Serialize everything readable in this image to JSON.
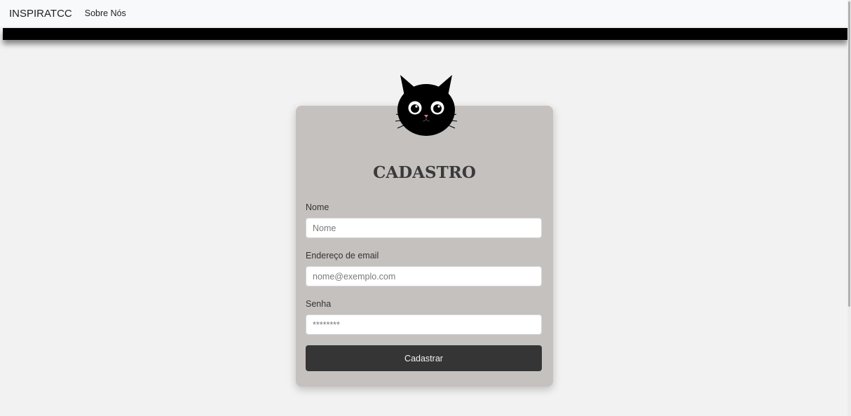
{
  "navbar": {
    "brand": "INSPIRATCC",
    "links": [
      {
        "label": "Sobre Nós"
      }
    ]
  },
  "form": {
    "title": "CADASTRO",
    "fields": [
      {
        "label": "Nome",
        "placeholder": "Nome"
      },
      {
        "label": "Endereço de email",
        "placeholder": "nome@exemplo.com"
      },
      {
        "label": "Senha",
        "placeholder": "********"
      }
    ],
    "submit_label": "Cadastrar"
  },
  "colors": {
    "card_background": "#c5c1bf",
    "button_background": "#353535",
    "page_background": "#f2f2f2",
    "bar": "#000000"
  },
  "icons": {
    "logo": "black-cat-icon"
  }
}
